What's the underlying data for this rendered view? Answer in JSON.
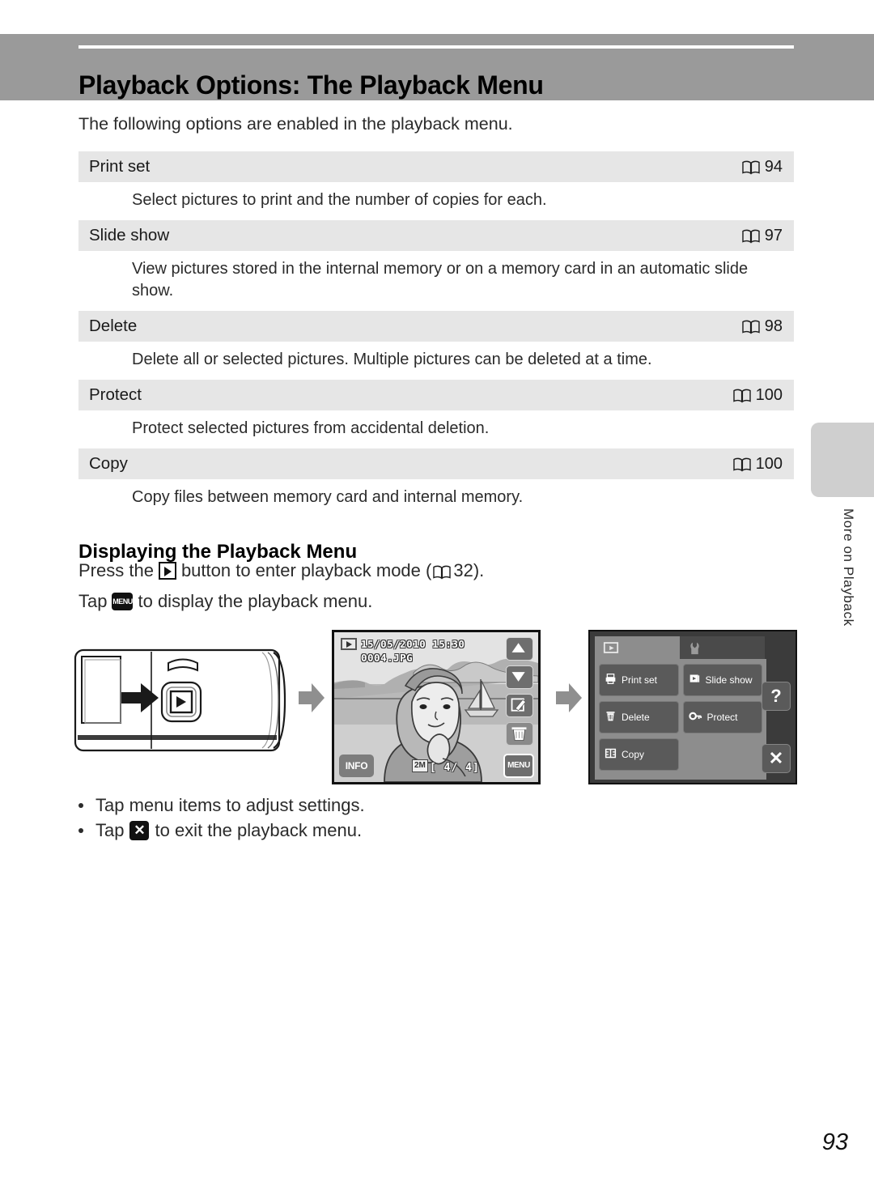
{
  "header": {
    "title": "Playback Options: The Playback Menu",
    "band_color": "#9a9a9a"
  },
  "intro": {
    "text": "The following options are enabled in the playback menu."
  },
  "options_table": {
    "rows": [
      {
        "name": "Print set",
        "ref_icon": "book-icon",
        "ref_page": "94",
        "description": "Select pictures to print and the number of copies for each."
      },
      {
        "name": "Slide show",
        "ref_icon": "book-icon",
        "ref_page": "97",
        "description": "View pictures stored in the internal memory or on a memory card in an automatic slide show."
      },
      {
        "name": "Delete",
        "ref_icon": "book-icon",
        "ref_page": "98",
        "description": "Delete all or selected pictures. Multiple pictures can be deleted at a time."
      },
      {
        "name": "Protect",
        "ref_icon": "book-icon",
        "ref_page": "100",
        "description": "Protect selected pictures from accidental deletion."
      },
      {
        "name": "Copy",
        "ref_icon": "book-icon",
        "ref_page": "100",
        "description": "Copy files between memory card and internal memory."
      }
    ]
  },
  "section": {
    "heading": "Displaying the Playback Menu",
    "instruction_1": {
      "before_icon": "Press the",
      "icon": "playback-button-icon",
      "after_icon": "button to enter playback mode (",
      "ref_icon": "book-icon",
      "ref_page": "32",
      "tail": ")."
    },
    "instruction_2": {
      "before_icon": "Tap",
      "icon": "menu-button-icon",
      "icon_label": "MENU",
      "after_icon": "to display the playback menu."
    },
    "bullets": [
      {
        "text": "Tap menu items to adjust settings.",
        "icon": null,
        "icon_label": null,
        "text_after": null
      },
      {
        "text": "Tap",
        "icon": "close-x-icon",
        "icon_label": "✕",
        "text_after": "to exit the playback menu."
      }
    ]
  },
  "illustration": {
    "camera_back": {
      "name": "camera-rear-view",
      "highlight": "playback-button"
    },
    "arrow_1": "arrow-right-icon",
    "arrow_2": "arrow-right-icon",
    "lcd_preview": {
      "playback_badge": "playback-mode-icon",
      "date": "15/05/2010  15:30",
      "filename": "0004.JPG",
      "buttons": {
        "up": "arrow-up-icon",
        "down": "arrow-down-icon",
        "edit": "edit-pencil-icon",
        "trash": "trash-icon",
        "menu_label": "MENU",
        "info_label": "INFO"
      },
      "image_size": "2M",
      "frame_counter": "[ 4/  4]"
    },
    "menu_panel": {
      "tabs": [
        {
          "icon": "playback-tab-icon",
          "active": true
        },
        {
          "icon": "setup-wrench-tab-icon",
          "active": false
        }
      ],
      "items": [
        {
          "label": "Print set",
          "icon": "printer-icon"
        },
        {
          "label": "Slide show",
          "icon": "slideshow-icon"
        },
        {
          "label": "Delete",
          "icon": "trash-icon"
        },
        {
          "label": "Protect",
          "icon": "key-icon"
        },
        {
          "label": "Copy",
          "icon": "copy-icon"
        }
      ],
      "help_label": "?",
      "close_label": "✕"
    }
  },
  "side_tab": {
    "label": "More on Playback"
  },
  "footer": {
    "page_number": "93"
  }
}
